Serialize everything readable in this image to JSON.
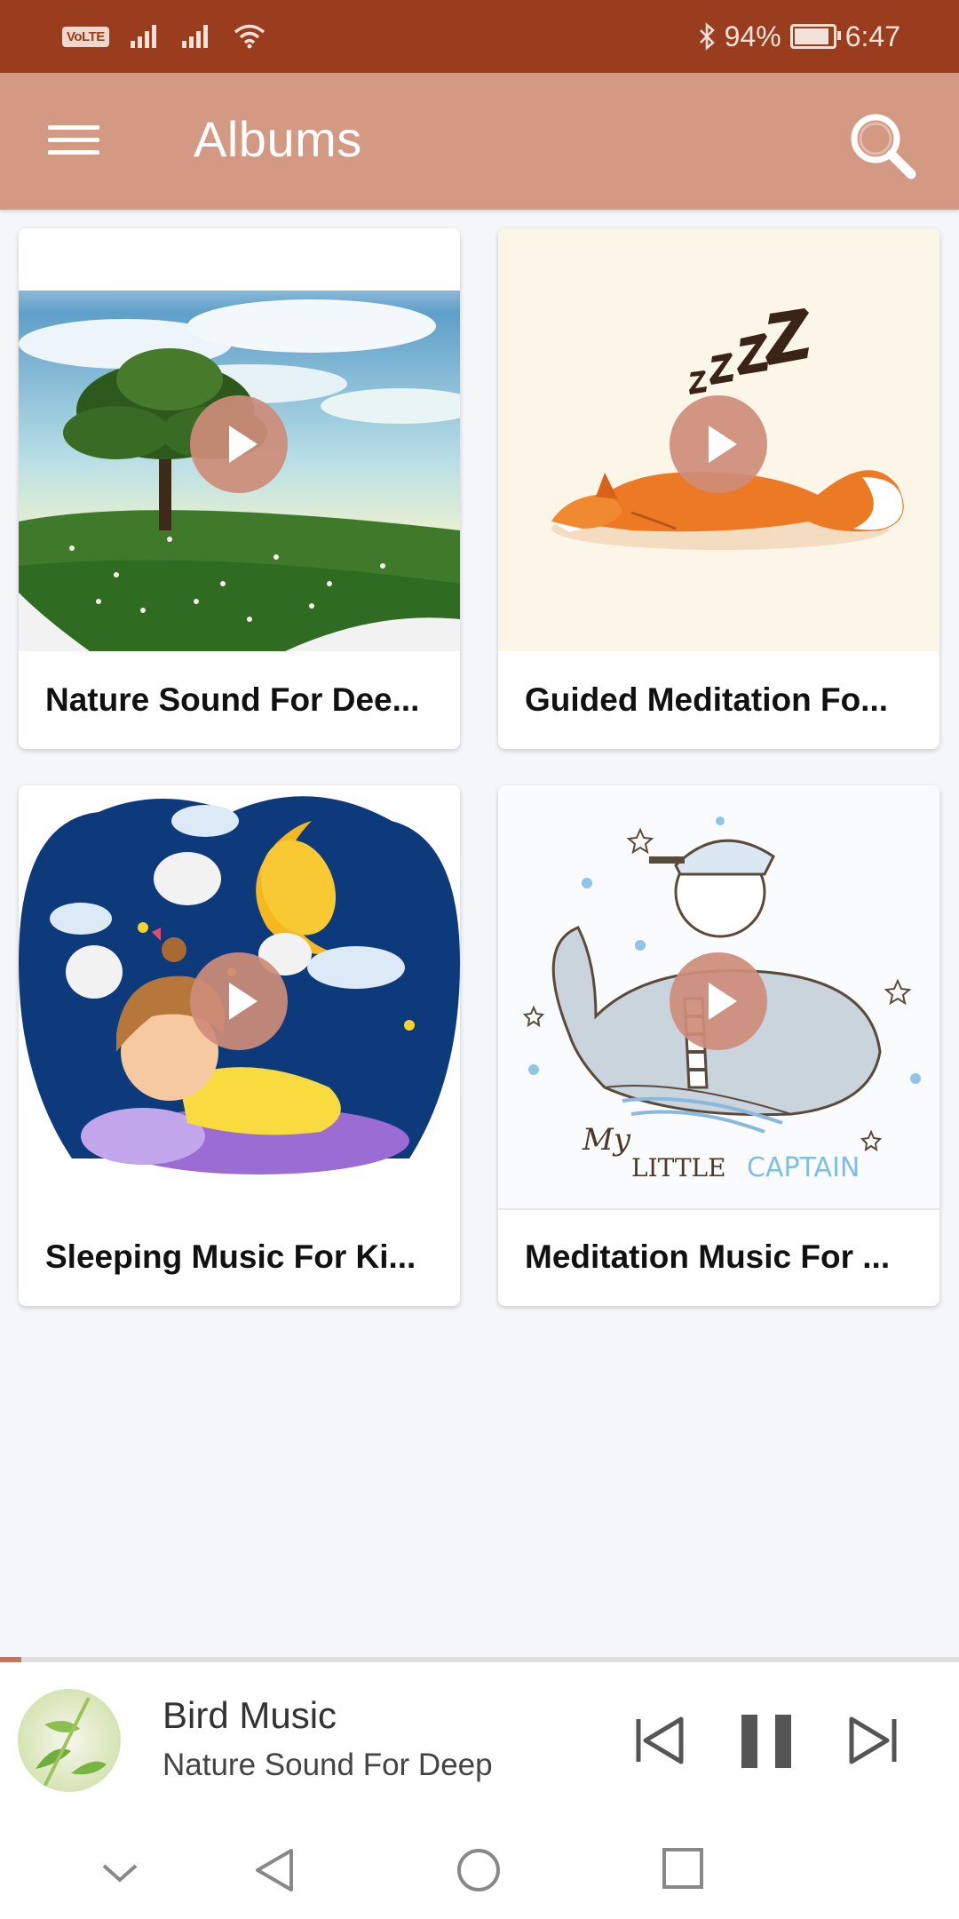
{
  "status_bar": {
    "volte": "VoLTE",
    "battery": "94%",
    "time": "6:47"
  },
  "app_bar": {
    "title": "Albums",
    "menu_icon": "hamburger-menu-icon",
    "search_icon": "search-icon"
  },
  "albums": [
    {
      "title": "Nature Sound For Dee...",
      "art": "tree-meadow-image"
    },
    {
      "title": "Guided Meditation Fo...",
      "art": "sleeping-fox-image"
    },
    {
      "title": "Sleeping Music For Ki...",
      "art": "sleeping-girl-moon-image"
    },
    {
      "title": "Meditation Music For ...",
      "art": "little-captain-whale-image",
      "caption_my": "My",
      "caption_little": "LITTLE",
      "caption_captain": "CAPTAIN"
    }
  ],
  "player": {
    "song": "Bird Music",
    "album": "Nature Sound For Deep",
    "progress": 0.022,
    "state": "playing"
  },
  "colors": {
    "status_bar": "#9a3d1e",
    "app_bar": "#d49983",
    "accent": "#c8745c"
  }
}
